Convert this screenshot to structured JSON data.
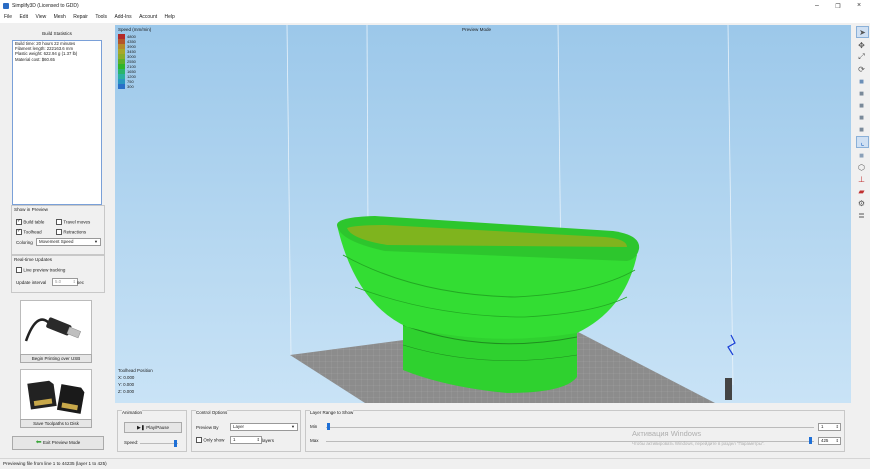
{
  "window": {
    "title": "Simplify3D (Licensed to GDD)"
  },
  "menu": [
    "File",
    "Edit",
    "View",
    "Mesh",
    "Repair",
    "Tools",
    "Add-Ins",
    "Account",
    "Help"
  ],
  "build_stats": {
    "heading": "Build Statistics",
    "lines": [
      "Build time: 20 hours 22 minutes",
      "Filament length: 222163.6 mm",
      "Plastic weight: 622.94 g (1.37 lb)",
      "Material cost: $60.65"
    ]
  },
  "show_in_preview": {
    "heading": "Show in Preview",
    "build_table": {
      "label": "Build table",
      "checked": true
    },
    "travel_moves": {
      "label": "Travel moves",
      "checked": false
    },
    "toolhead": {
      "label": "Toolhead",
      "checked": true
    },
    "retractions": {
      "label": "Retractions",
      "checked": false
    },
    "coloring_label": "Coloring",
    "coloring_value": "Movement Speed"
  },
  "realtime": {
    "heading": "Real-time Updates",
    "live_label": "Live preview tracking",
    "interval_label": "Update interval",
    "interval_value": "5.0",
    "interval_unit": "sec"
  },
  "usb_button": "Begin Printing over USB",
  "disk_button": "Save Toolpaths to Disk",
  "exit_button": "Exit Preview Mode",
  "viewport": {
    "mode": "Preview Mode",
    "legend_title": "Speed (mm/min)",
    "legend": [
      {
        "value": "4800",
        "color": "#b22a2a"
      },
      {
        "value": "4350",
        "color": "#b5552a"
      },
      {
        "value": "3900",
        "color": "#b58a2a"
      },
      {
        "value": "3450",
        "color": "#a8a82a"
      },
      {
        "value": "3000",
        "color": "#8aac2a"
      },
      {
        "value": "2550",
        "color": "#5fb02a"
      },
      {
        "value": "2100",
        "color": "#2fb52a"
      },
      {
        "value": "1650",
        "color": "#2ab56a"
      },
      {
        "value": "1200",
        "color": "#2ab0a0"
      },
      {
        "value": "750",
        "color": "#2a98c0"
      },
      {
        "value": "300",
        "color": "#2a70c8"
      }
    ],
    "toolhead_position": {
      "heading": "Toolhead Position",
      "x": "X: 0.000",
      "y": "Y: 0.000",
      "z": "Z: 0.000"
    }
  },
  "animation": {
    "heading": "Animation",
    "play_label": "Play/Pause",
    "speed_label": "Speed:"
  },
  "control_options": {
    "heading": "Control Options",
    "preview_by_label": "Preview By",
    "preview_by_value": "Layer",
    "only_show_label": "Only show",
    "only_show_value": "1",
    "layers_label": "layers"
  },
  "layer_range": {
    "heading": "Layer Range to Show",
    "min_label": "Min",
    "max_label": "Max",
    "min_value": "1",
    "max_value": "425"
  },
  "watermark": {
    "line1": "Активация Windows",
    "line2": "Чтобы активировать Windows, перейдите в раздел \"Параметры\"."
  },
  "status": "Previewing file from line 1 to 44235 (layer 1 to 425)",
  "colors": {
    "accent": "#1e6fd6",
    "model_green": "#33dd33"
  }
}
